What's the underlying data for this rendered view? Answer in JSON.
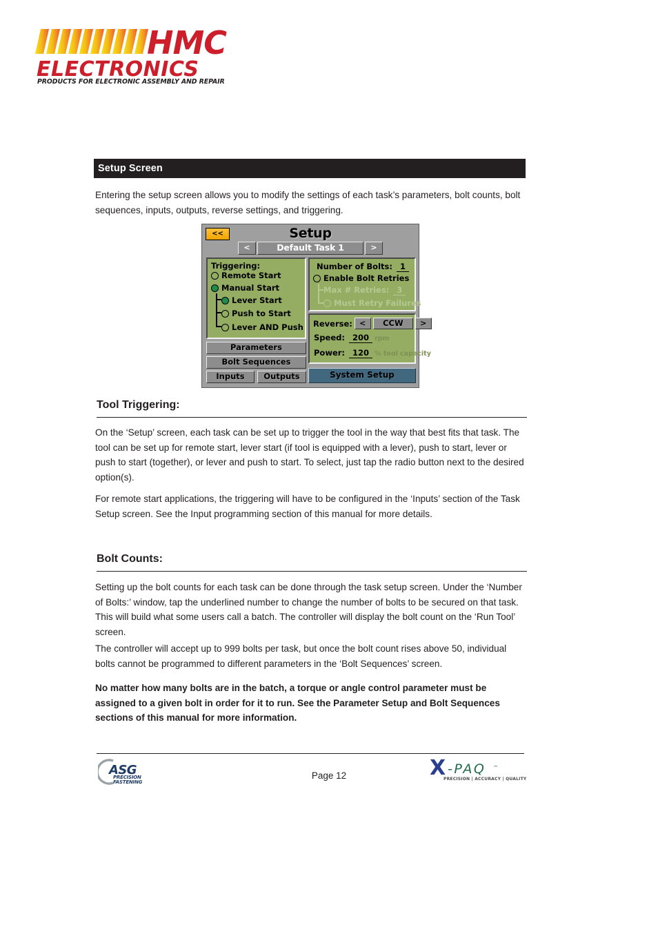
{
  "brand": {
    "logo_primary": "HMC",
    "logo_secondary": "ELECTRONICS",
    "logo_tagline": "PRODUCTS FOR ELECTRONIC ASSEMBLY AND REPAIR",
    "accent_red": "#cc1f2b",
    "accent_yellow": "#f4c21a",
    "accent_orange": "#ef7f28"
  },
  "section": {
    "title": "Setup Screen",
    "bar_bg": "#231f20",
    "bar_fg": "#ffffff"
  },
  "intro": "Entering the setup screen allows you to modify the settings of each task’s parameters, bolt counts, bolt sequences, inputs, outputs, reverse settings,  and triggering.",
  "device": {
    "title": "Setup",
    "back_label": "<<",
    "task": {
      "prev_label": "<",
      "name": "Default Task 1",
      "next_label": ">"
    },
    "triggering": {
      "label": "Triggering:",
      "options": [
        {
          "label": "Remote Start",
          "selected": false,
          "nested": false,
          "disabled": false
        },
        {
          "label": "Manual Start",
          "selected": true,
          "nested": false,
          "disabled": false
        },
        {
          "label": "Lever Start",
          "selected": true,
          "nested": true,
          "disabled": false
        },
        {
          "label": "Push to Start",
          "selected": false,
          "nested": true,
          "disabled": false
        },
        {
          "label": "Lever AND Push",
          "selected": false,
          "nested": true,
          "disabled": false
        }
      ]
    },
    "bolts": {
      "count_label": "Number of Bolts:",
      "count_value": "1",
      "retries_label": "Enable Bolt Retries",
      "retries_selected": false,
      "max_retries_label": "Max # Retries:",
      "max_retries_value": "3",
      "must_retry_label": "Must Retry Failures",
      "must_retry_selected": false
    },
    "reverse": {
      "label": "Reverse:",
      "prev_label": "<",
      "value": "CCW",
      "next_label": ">",
      "speed_label": "Speed:",
      "speed_value": "200",
      "speed_unit": "rpm",
      "power_label": "Power:",
      "power_value": "120",
      "power_unit": "% tool capacity"
    },
    "buttons": {
      "parameters": "Parameters",
      "bolt_sequences": "Bolt Sequences",
      "inputs": "Inputs",
      "outputs": "Outputs",
      "system_setup": "System Setup"
    },
    "colors": {
      "panel_green": "#94ad63",
      "chrome_grey": "#9f9f9f",
      "system_blue": "#41687f",
      "back_yellow": "#f0a500",
      "radio_on": "#1f8c4a"
    }
  },
  "tool_triggering": {
    "heading": "Tool Triggering:",
    "p1": "On the ‘Setup’ screen, each task can be set up to trigger the tool in the way that best fits that task.  The tool can be set up for remote start, lever start (if tool is equipped with a lever), push to start, lever or push to start (together), or lever and push to start.  To select, just tap the radio button next to the desired option(s).",
    "p2": "For remote start applications, the triggering will have to be configured in the ‘Inputs’ section of the Task Setup screen.  See the Input programming section of this manual for more details."
  },
  "bolt_counts": {
    "heading": "Bolt Counts:",
    "p1": "Setting up the bolt counts for each task can be done through the task setup screen.  Under the ‘Number of Bolts:’ window, tap the underlined number to change the number of bolts to be secured on that task.  This will build what some users call a batch.  The controller will display the bolt count on the ‘Run Tool’ screen.",
    "p2": "The controller will accept up to 999 bolts per task, but once the bolt count rises above 50, individual bolts cannot be programmed to different parameters in the ‘Bolt Sequences’ screen.",
    "p3": "No matter how many bolts are in the batch, a torque or angle control parameter must be assigned to a given bolt in order for it to run.  See the Parameter Setup and Bolt Sequences sections of this manual for more information."
  },
  "footer": {
    "page_label": "Page 12",
    "asg_logo": "ASG",
    "asg_sub1": "PRECISION",
    "asg_sub2": "FASTENING",
    "xpaq_logo": "X-PAQ",
    "xpaq_tagline": "PRECISION | ACCURACY | QUALITY"
  }
}
